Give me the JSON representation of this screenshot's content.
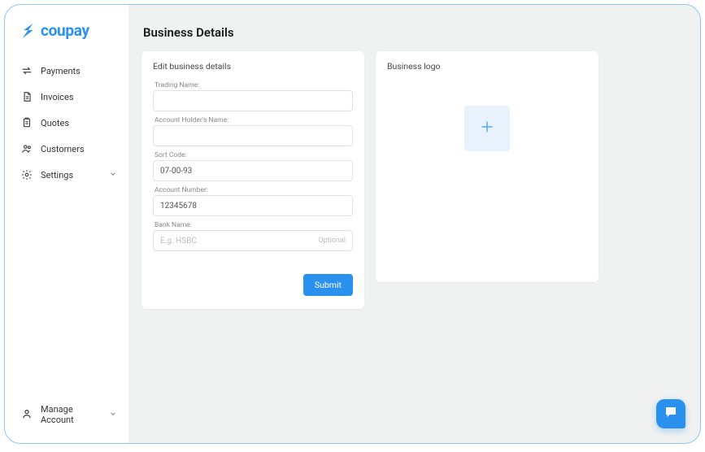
{
  "brand": {
    "name": "coupay"
  },
  "sidebar": {
    "items": [
      {
        "label": "Payments"
      },
      {
        "label": "Invoices"
      },
      {
        "label": "Quotes"
      },
      {
        "label": "Customers"
      },
      {
        "label": "Settings"
      }
    ],
    "bottom": {
      "label": "Manage Account"
    }
  },
  "page": {
    "title": "Business Details"
  },
  "editCard": {
    "header": "Edit business details",
    "fields": {
      "trading_name": {
        "label": "Trading Name:",
        "value": ""
      },
      "account_holder": {
        "label": "Account Holder's Name:",
        "value": ""
      },
      "sort_code": {
        "label": "Sort Code:",
        "value": "07-00-93"
      },
      "account_number": {
        "label": "Account Number:",
        "value": "12345678"
      },
      "bank_name": {
        "label": "Bank Name:",
        "value": "",
        "placeholder": "E.g. HSBC",
        "optional": "Optional"
      }
    },
    "submit": "Submit"
  },
  "logoCard": {
    "header": "Business logo"
  }
}
